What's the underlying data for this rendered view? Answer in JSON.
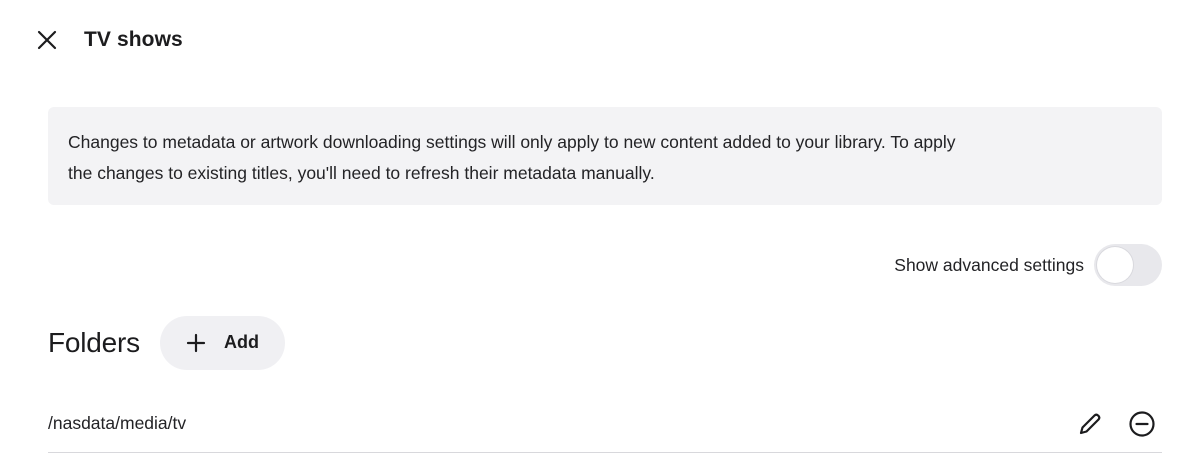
{
  "header": {
    "close_icon": "close-icon",
    "title": "TV shows"
  },
  "notice": {
    "line1": "Changes to metadata or artwork downloading settings will only apply to new content added to your library. To apply",
    "line2": "the changes to existing titles, you'll need to refresh their metadata manually."
  },
  "advanced": {
    "label": "Show advanced settings",
    "enabled": false
  },
  "folders": {
    "title": "Folders",
    "add_label": "Add",
    "add_icon": "plus-icon",
    "items": [
      {
        "path": "/nasdata/media/tv",
        "edit_icon": "pencil-icon",
        "remove_icon": "minus-circle-icon"
      }
    ]
  },
  "colors": {
    "notice_bg": "#f3f3f5",
    "button_bg": "#f0f0f3",
    "toggle_off": "#e8e8ec",
    "text": "#1c1c1e"
  }
}
